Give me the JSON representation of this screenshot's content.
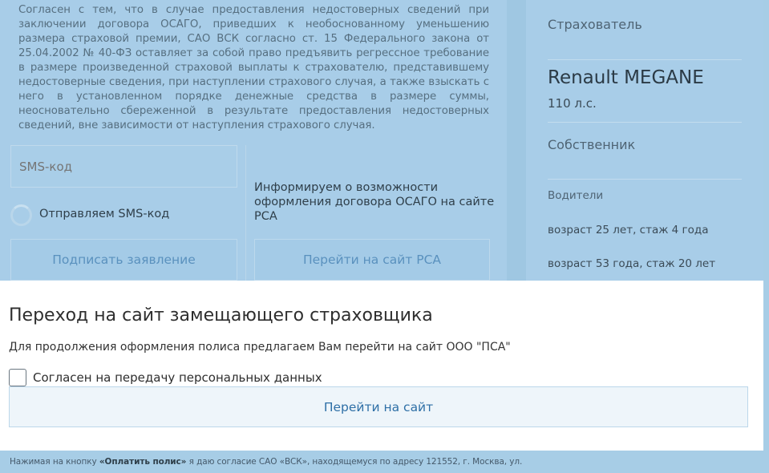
{
  "legal_text": "Согласен с тем, что в случае предоставления недостоверных сведений при заключении договора ОСАГО, приведших к необоснованному уменьшению размера страховой премии, САО ВСК согласно ст. 15 Федерального закона от 25.04.2002 № 40-ФЗ оставляет за собой право предъявить регрессное требование в размере произведенной страховой выплаты к страхователю, представившему недостоверные сведения, при наступлении страхового случая, а также взыскать с него в установленном порядке денежные средства в размере суммы, неосновательно сбереженной в результате предоставления недостоверных сведений, вне зависимости от наступления страхового случая.",
  "sms": {
    "placeholder": "SMS-код",
    "sending_text": "Отправляем SMS-код"
  },
  "inform_text": "Информируем о возможности оформления договора ОСАГО на сайте РСА",
  "buttons": {
    "sign": "Подписать заявление",
    "rsa": "Перейти на сайт РСА"
  },
  "sidebar": {
    "insurer_label": "Страхователь",
    "car": "Renault MEGANE",
    "power": "110 л.с.",
    "owner_label": "Собственник",
    "drivers_label": "Водители",
    "drivers": [
      "возраст 25 лет, стаж 4 года",
      "возраст 53 года, стаж 20 лет"
    ]
  },
  "modal": {
    "title": "Переход на сайт замещающего страховщика",
    "description": "Для продолжения оформления полиса предлагаем Вам перейти на сайт ООО \"ПСА\"",
    "consent_label": "Согласен на передачу персональных данных",
    "go_button": "Перейти на сайт"
  },
  "footer": {
    "prefix": "Нажимая на кнопку",
    "button_ref": "«Оплатить полис»",
    "suffix": "я даю согласие САО «ВСК», находящемуся по адресу 121552, г. Москва, ул."
  }
}
